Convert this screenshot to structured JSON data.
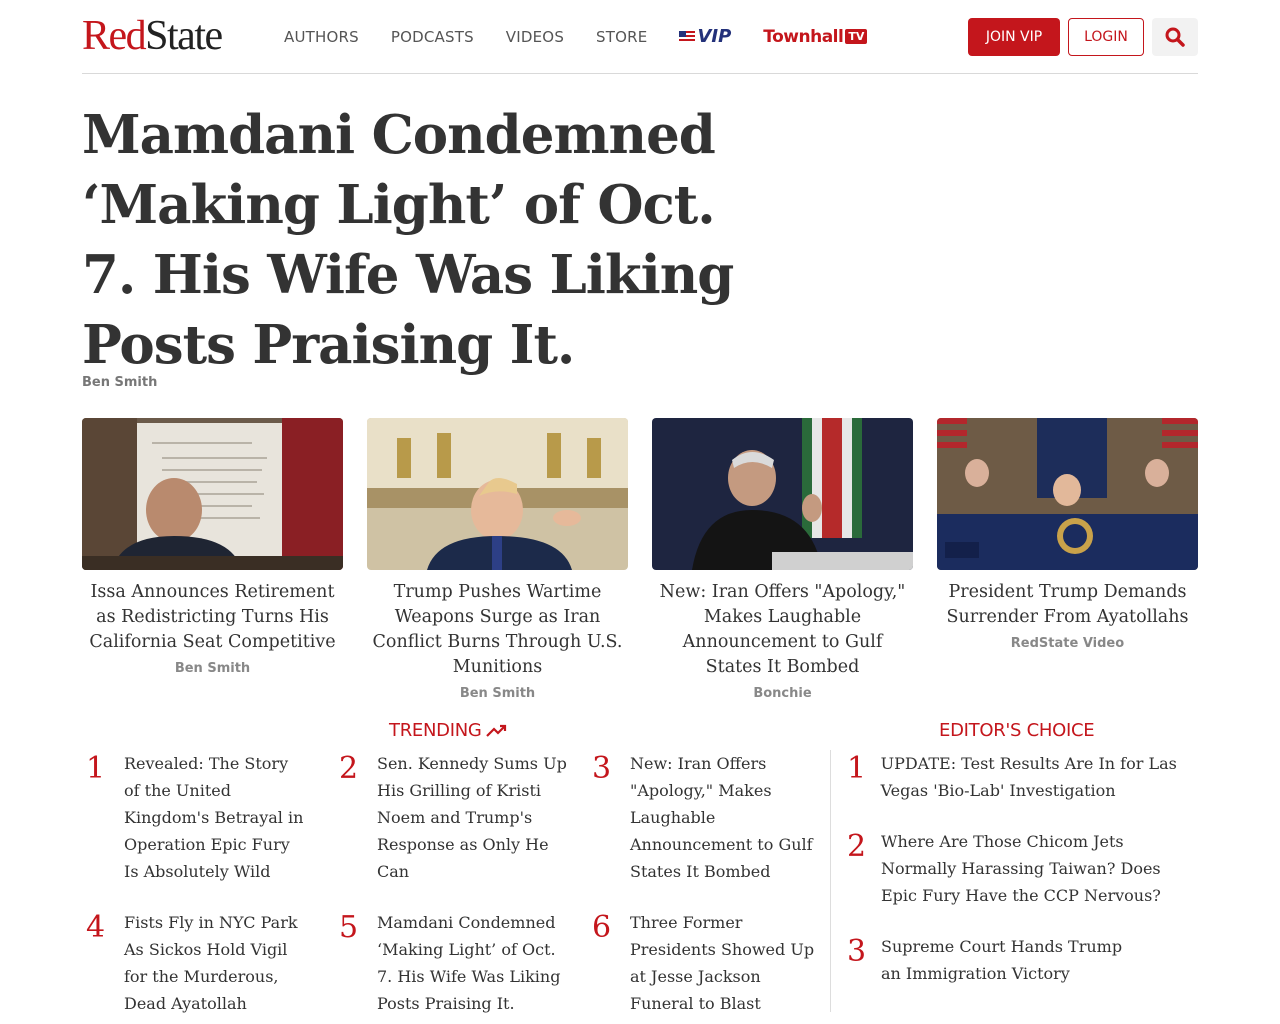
{
  "header": {
    "logo_red": "Red",
    "logo_dark": "State",
    "nav": [
      "AUTHORS",
      "PODCASTS",
      "VIDEOS",
      "STORE"
    ],
    "vip_label": "VIP",
    "townhall_label": "Townhall",
    "townhall_tv": "TV",
    "join_label": "JOIN VIP",
    "login_label": "LOGIN"
  },
  "headline": {
    "title": "Mamdani Condemned ‘Making Light’ of Oct. 7. His Wife Was Liking Posts Praising It.",
    "author": "Ben Smith"
  },
  "cards": [
    {
      "title": "Issa Announces Retirement as Redistricting Turns His California Seat Competitive",
      "author": "Ben Smith"
    },
    {
      "title": "Trump Pushes Wartime Weapons Surge as Iran Conflict Burns Through U.S. Munitions",
      "author": "Ben Smith"
    },
    {
      "title": "New: Iran Offers \"Apology,\" Makes Laughable Announcement to Gulf States It Bombed",
      "author": "Bonchie"
    },
    {
      "title": "President Trump Demands Surrender From Ayatollahs",
      "author": "RedState Video"
    }
  ],
  "trending": {
    "heading": "TRENDING",
    "items": [
      {
        "num": "1",
        "text": "Revealed: The Story of the United Kingdom's Betrayal in Operation Epic Fury Is Absolutely Wild"
      },
      {
        "num": "2",
        "text": "Sen. Kennedy Sums Up His Grilling of Kristi Noem and Trump's Response as Only He Can"
      },
      {
        "num": "3",
        "text": "New: Iran Offers \"Apology,\" Makes Laughable Announcement to Gulf States It Bombed"
      },
      {
        "num": "4",
        "text": "Fists Fly in NYC Park As Sickos Hold Vigil for the Murderous, Dead Ayatollah Khamenei"
      },
      {
        "num": "5",
        "text": "Mamdani Condemned ‘Making Light’ of Oct. 7. His Wife Was Liking Posts Praising It."
      },
      {
        "num": "6",
        "text": "Three Former Presidents Showed Up at Jesse Jackson Funeral to Blast MAGA, Only Two"
      }
    ]
  },
  "editors": {
    "heading": "EDITOR'S CHOICE",
    "items": [
      {
        "num": "1",
        "text": "UPDATE: Test Results Are In for Las Vegas 'Bio-Lab' Investigation"
      },
      {
        "num": "2",
        "text": "Where Are Those Chicom Jets Normally Harassing Taiwan? Does Epic Fury Have the CCP Nervous?"
      },
      {
        "num": "3",
        "text": "Supreme Court Hands Trump an Immigration Victory"
      }
    ]
  }
}
